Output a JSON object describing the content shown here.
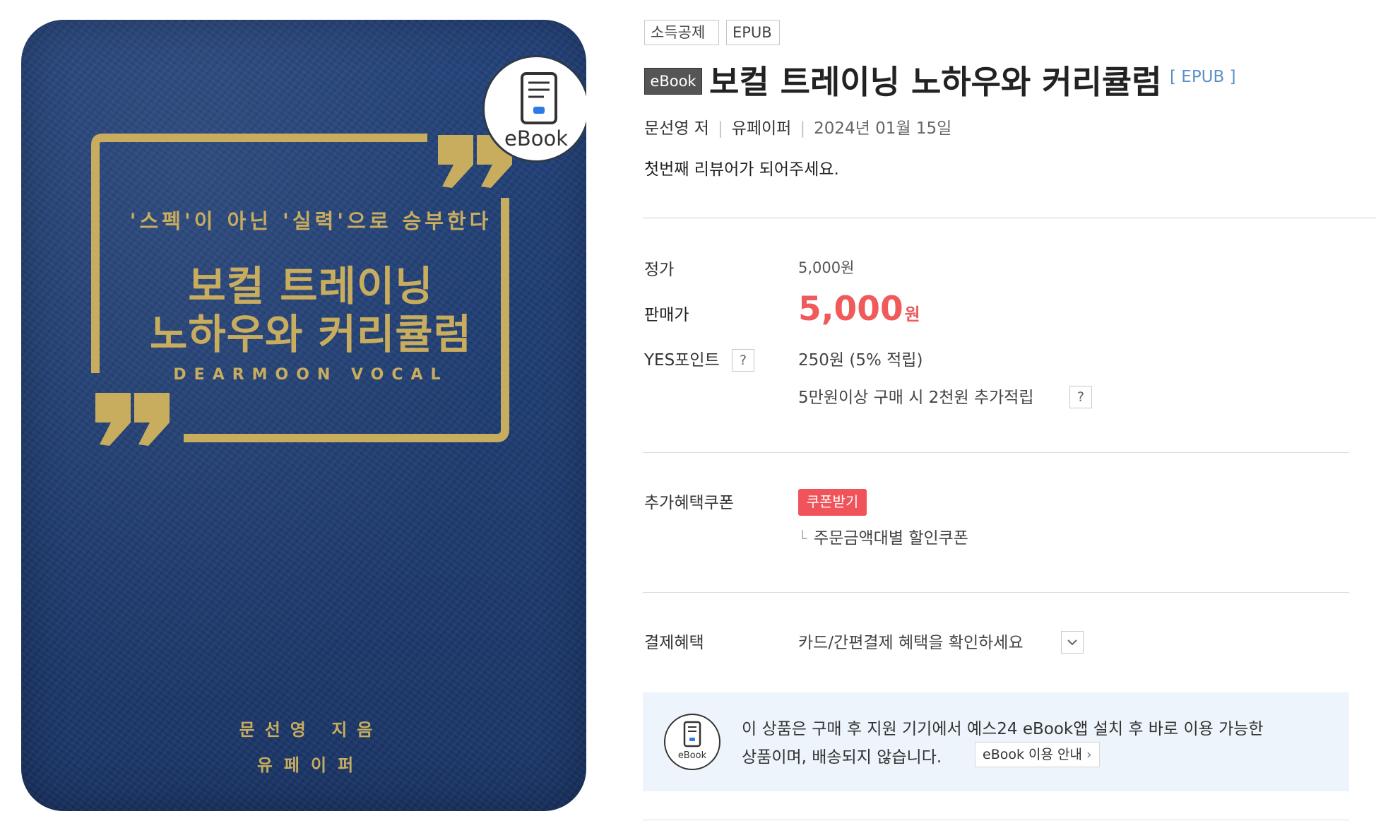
{
  "cover": {
    "tagline": "'스펙'이 아닌 '실력'으로 승부한다",
    "title_line1": "보컬 트레이닝",
    "title_line2": "노하우와 커리큘럼",
    "brand": "DEARMOON VOCAL",
    "author": "문선영 지음",
    "publisher": "유페이퍼",
    "badge_label": "eBook",
    "colors": {
      "background": "#1f3d72",
      "gold": "#c9ad5e"
    }
  },
  "tags": [
    "소득공제",
    "EPUB"
  ],
  "product": {
    "type_label": "eBook",
    "title": "보컬 트레이닝 노하우와 커리큘럼",
    "format": "[ EPUB ]",
    "author": "문선영 저",
    "publisher": "유페이퍼",
    "date": "2024년 01월 15일",
    "review_prompt": "첫번째 리뷰어가 되어주세요."
  },
  "price": {
    "list_label": "정가",
    "list_value": "5,000원",
    "sale_label": "판매가",
    "sale_value": "5,000",
    "sale_unit": "원",
    "sale_color": "#f05a5a",
    "point_label": "YES포인트",
    "point_value": "250원 (5% 적립)",
    "extra_point": "5만원이상 구매 시 2천원 추가적립",
    "help_icon_text": "?"
  },
  "coupon": {
    "label": "추가혜택쿠폰",
    "button": "쿠폰받기",
    "button_color": "#f0545a",
    "sub_item": "주문금액대별 할인쿠폰"
  },
  "payment": {
    "label": "결제혜택",
    "value": "카드/간편결제 혜택을 확인하세요"
  },
  "info": {
    "icon_label": "eBook",
    "line1": "이 상품은 구매 후 지원 기기에서 예스24 eBook앱 설치 후 바로 이용 가능한",
    "line2": "상품이며, 배송되지 않습니다.",
    "link": "eBook 이용 안내",
    "background": "#edf4fb"
  }
}
